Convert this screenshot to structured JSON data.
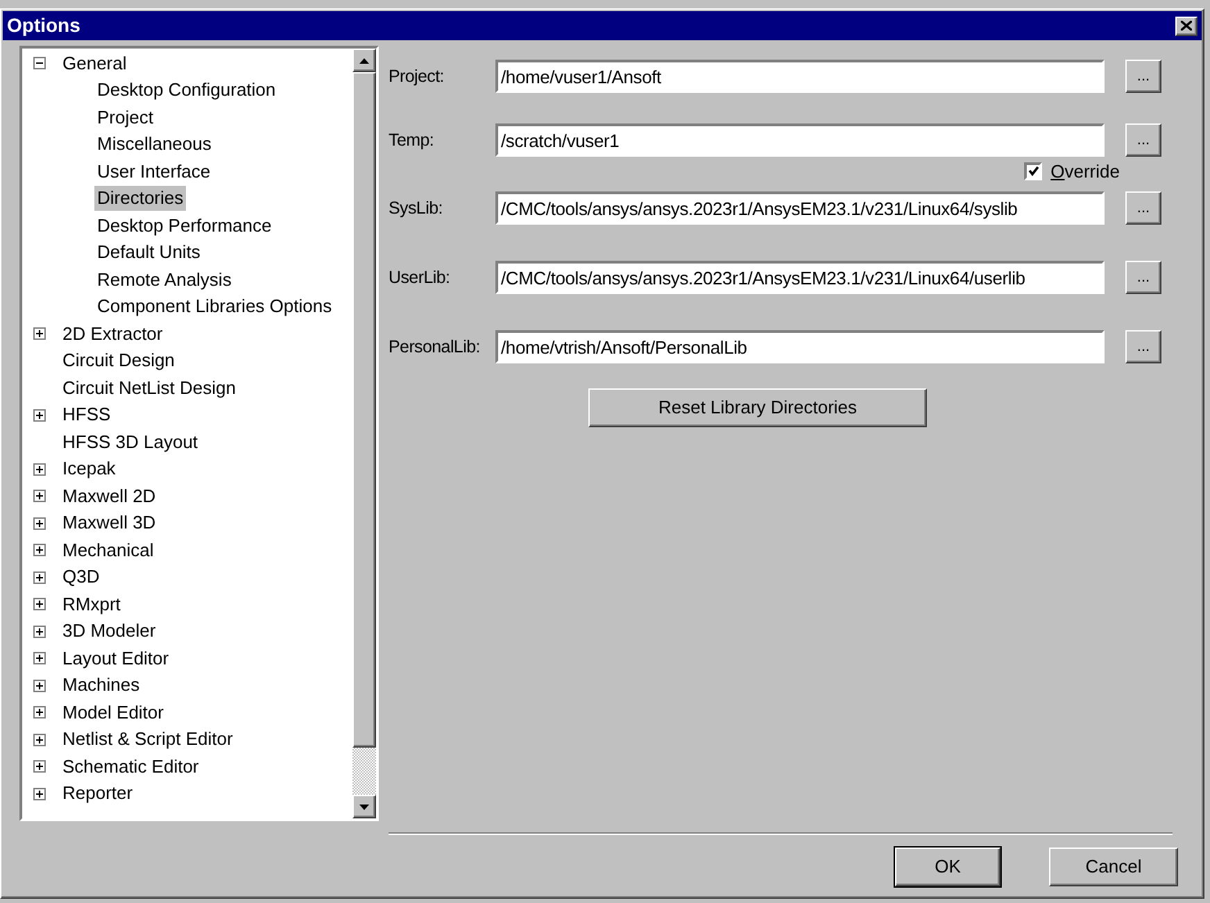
{
  "window": {
    "title": "Options"
  },
  "tree": [
    {
      "label": "General",
      "kind": "group",
      "expanded": true,
      "selected": false,
      "children": [
        {
          "label": "Desktop Configuration",
          "selected": false
        },
        {
          "label": "Project",
          "selected": false
        },
        {
          "label": "Miscellaneous",
          "selected": false
        },
        {
          "label": "User Interface",
          "selected": false
        },
        {
          "label": "Directories",
          "selected": true
        },
        {
          "label": "Desktop Performance",
          "selected": false
        },
        {
          "label": "Default Units",
          "selected": false
        },
        {
          "label": "Remote Analysis",
          "selected": false
        },
        {
          "label": "Component Libraries Options",
          "selected": false
        }
      ]
    },
    {
      "label": "2D Extractor",
      "kind": "group",
      "expanded": false,
      "selected": false
    },
    {
      "label": "Circuit Design",
      "kind": "leaf",
      "selected": false
    },
    {
      "label": "Circuit NetList Design",
      "kind": "leaf",
      "selected": false
    },
    {
      "label": "HFSS",
      "kind": "group",
      "expanded": false,
      "selected": false
    },
    {
      "label": "HFSS 3D Layout",
      "kind": "leaf",
      "selected": false
    },
    {
      "label": "Icepak",
      "kind": "group",
      "expanded": false,
      "selected": false
    },
    {
      "label": "Maxwell 2D",
      "kind": "group",
      "expanded": false,
      "selected": false
    },
    {
      "label": "Maxwell 3D",
      "kind": "group",
      "expanded": false,
      "selected": false
    },
    {
      "label": "Mechanical",
      "kind": "group",
      "expanded": false,
      "selected": false
    },
    {
      "label": "Q3D",
      "kind": "group",
      "expanded": false,
      "selected": false
    },
    {
      "label": "RMxprt",
      "kind": "group",
      "expanded": false,
      "selected": false
    },
    {
      "label": "3D Modeler",
      "kind": "group",
      "expanded": false,
      "selected": false
    },
    {
      "label": "Layout Editor",
      "kind": "group",
      "expanded": false,
      "selected": false
    },
    {
      "label": "Machines",
      "kind": "group",
      "expanded": false,
      "selected": false
    },
    {
      "label": "Model Editor",
      "kind": "group",
      "expanded": false,
      "selected": false
    },
    {
      "label": "Netlist & Script Editor",
      "kind": "group",
      "expanded": false,
      "selected": false
    },
    {
      "label": "Schematic Editor",
      "kind": "group",
      "expanded": false,
      "selected": false
    },
    {
      "label": "Reporter",
      "kind": "group",
      "expanded": false,
      "selected": false
    }
  ],
  "fields": [
    {
      "label": "Project:",
      "value": "/home/vuser1/Ansoft",
      "browse": "..."
    },
    {
      "label": "Temp:",
      "value": "/scratch/vuser1",
      "browse": "...",
      "override": {
        "label": "Override",
        "checked": true
      }
    },
    {
      "label": "SysLib:",
      "value": "/CMC/tools/ansys/ansys.2023r1/AnsysEM23.1/v231/Linux64/syslib",
      "browse": "..."
    },
    {
      "label": "UserLib:",
      "value": "/CMC/tools/ansys/ansys.2023r1/AnsysEM23.1/v231/Linux64/userlib",
      "browse": "..."
    },
    {
      "label": "PersonalLib:",
      "value": "/home/vtrish/Ansoft/PersonalLib",
      "browse": "..."
    }
  ],
  "reset_button": "Reset Library Directories",
  "buttons": [
    "OK",
    "Cancel"
  ]
}
